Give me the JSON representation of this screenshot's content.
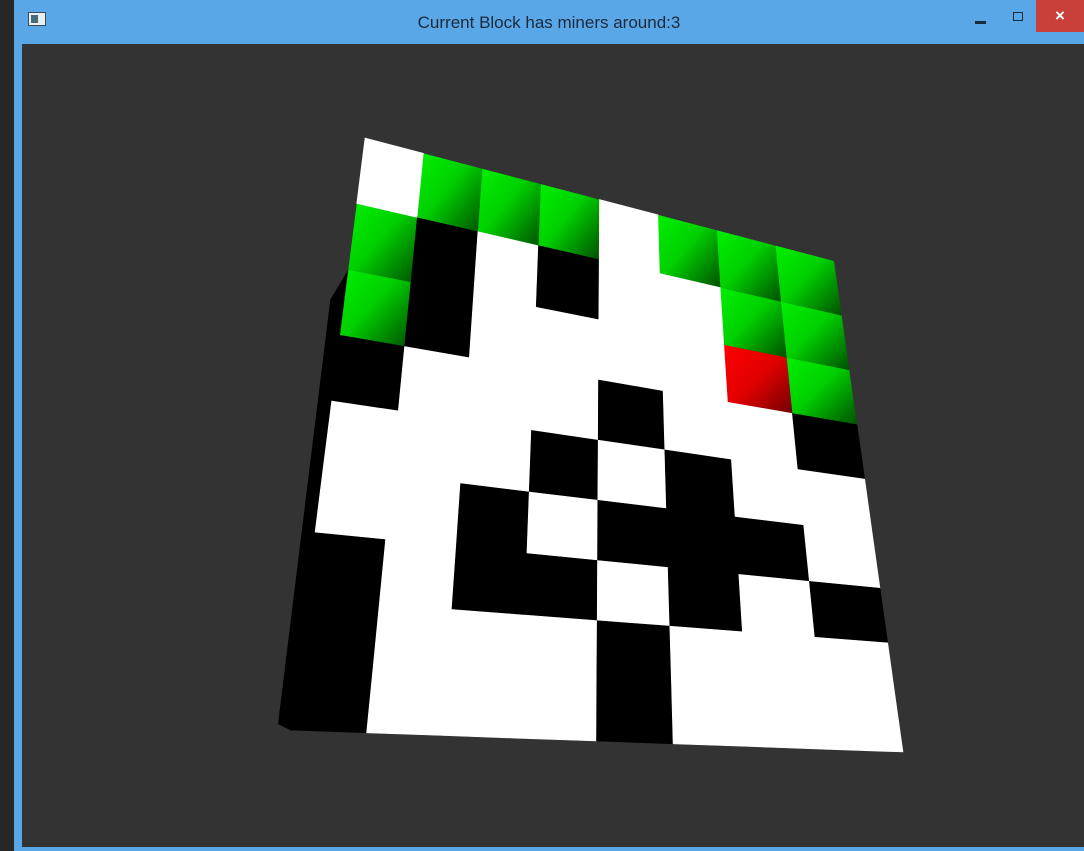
{
  "window": {
    "title": "Current Block has miners around:3",
    "controls": {
      "minimize_icon": "minimize-icon",
      "maximize_icon": "maximize-icon",
      "close_glyph": "×"
    }
  },
  "game": {
    "type": "3d-minesweeper-board",
    "grid_columns": 8,
    "grid_rows": 9,
    "cell_states": {
      "G": "revealed-green",
      "R": "current-red",
      "W": "unrevealed-white",
      "B": "black"
    },
    "grid": [
      [
        "W",
        "G",
        "G",
        "G",
        "W",
        "G",
        "G",
        "G"
      ],
      [
        "G",
        "B",
        "W",
        "B",
        "W",
        "W",
        "G",
        "G"
      ],
      [
        "G",
        "B",
        "W",
        "W",
        "W",
        "W",
        "R",
        "G"
      ],
      [
        "B",
        "W",
        "W",
        "W",
        "B",
        "W",
        "W",
        "B"
      ],
      [
        "W",
        "W",
        "W",
        "B",
        "W",
        "B",
        "W",
        "W"
      ],
      [
        "W",
        "W",
        "B",
        "W",
        "B",
        "B",
        "B",
        "W"
      ],
      [
        "B",
        "W",
        "B",
        "B",
        "W",
        "B",
        "W",
        "B"
      ],
      [
        "B",
        "W",
        "W",
        "W",
        "B",
        "W",
        "W",
        "W"
      ],
      [
        "B",
        "W",
        "W",
        "W",
        "B",
        "W",
        "W",
        "W"
      ]
    ],
    "colors": {
      "background": "#333333",
      "green": "#00e600",
      "red": "#ff0000",
      "white": "#ffffff",
      "black": "#000000"
    }
  }
}
